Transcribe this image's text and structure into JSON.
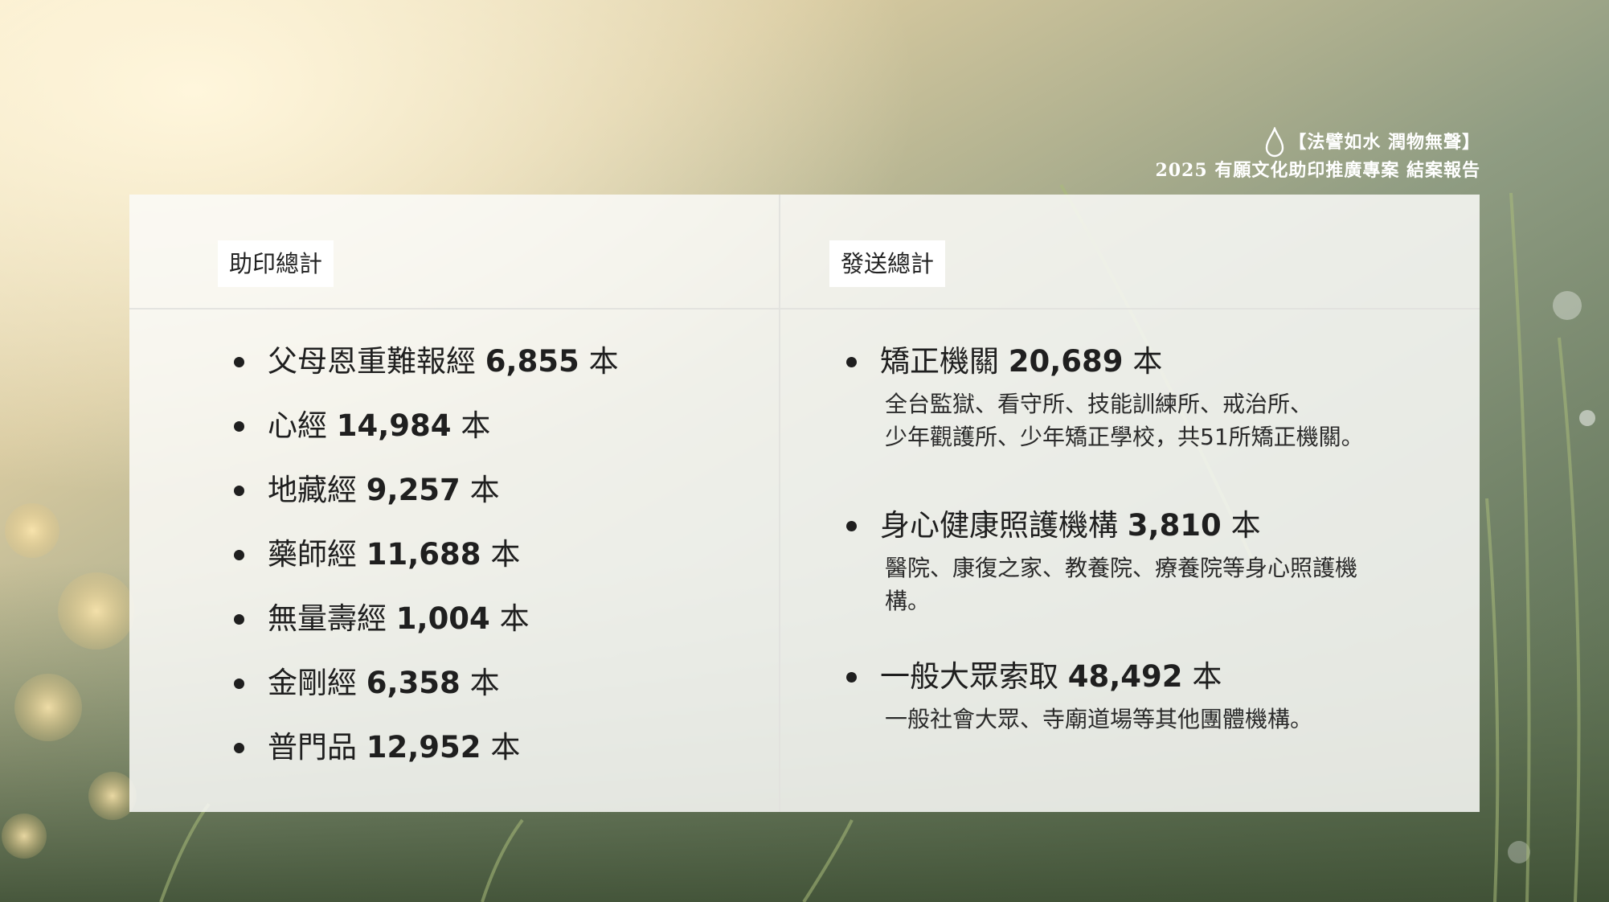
{
  "header": {
    "line1": "【法譬如水 潤物無聲】",
    "line2": "2025 有願文化助印推廣專案 結案報告"
  },
  "left": {
    "heading": "助印總計",
    "items": [
      {
        "name": "父母恩重難報經",
        "count": "6,855",
        "unit": "本"
      },
      {
        "name": "心經",
        "count": "14,984",
        "unit": "本"
      },
      {
        "name": "地藏經",
        "count": "9,257",
        "unit": "本"
      },
      {
        "name": "藥師經",
        "count": "11,688",
        "unit": "本"
      },
      {
        "name": "無量壽經",
        "count": "1,004",
        "unit": "本"
      },
      {
        "name": "金剛經",
        "count": "6,358",
        "unit": "本"
      },
      {
        "name": "普門品",
        "count": "12,952",
        "unit": "本"
      }
    ]
  },
  "right": {
    "heading": "發送總計",
    "items": [
      {
        "name": "矯正機關",
        "count": "20,689",
        "unit": "本",
        "desc_lines": [
          "全台監獄、看守所、技能訓練所、戒治所、",
          "少年觀護所、少年矯正學校，共51所矯正機關。"
        ]
      },
      {
        "name": "身心健康照護機構",
        "count": "3,810",
        "unit": "本",
        "desc_lines": [
          "醫院、康復之家、教養院、療養院等身心照護機",
          "構。"
        ]
      },
      {
        "name": "一般大眾索取",
        "count": "48,492",
        "unit": "本",
        "desc_lines": [
          "一般社會大眾、寺廟道場等其他團體機構。"
        ]
      }
    ]
  },
  "colors": {
    "panel": "#fafaf8",
    "text": "#1f1f1f",
    "header_text": "#ffffff"
  }
}
